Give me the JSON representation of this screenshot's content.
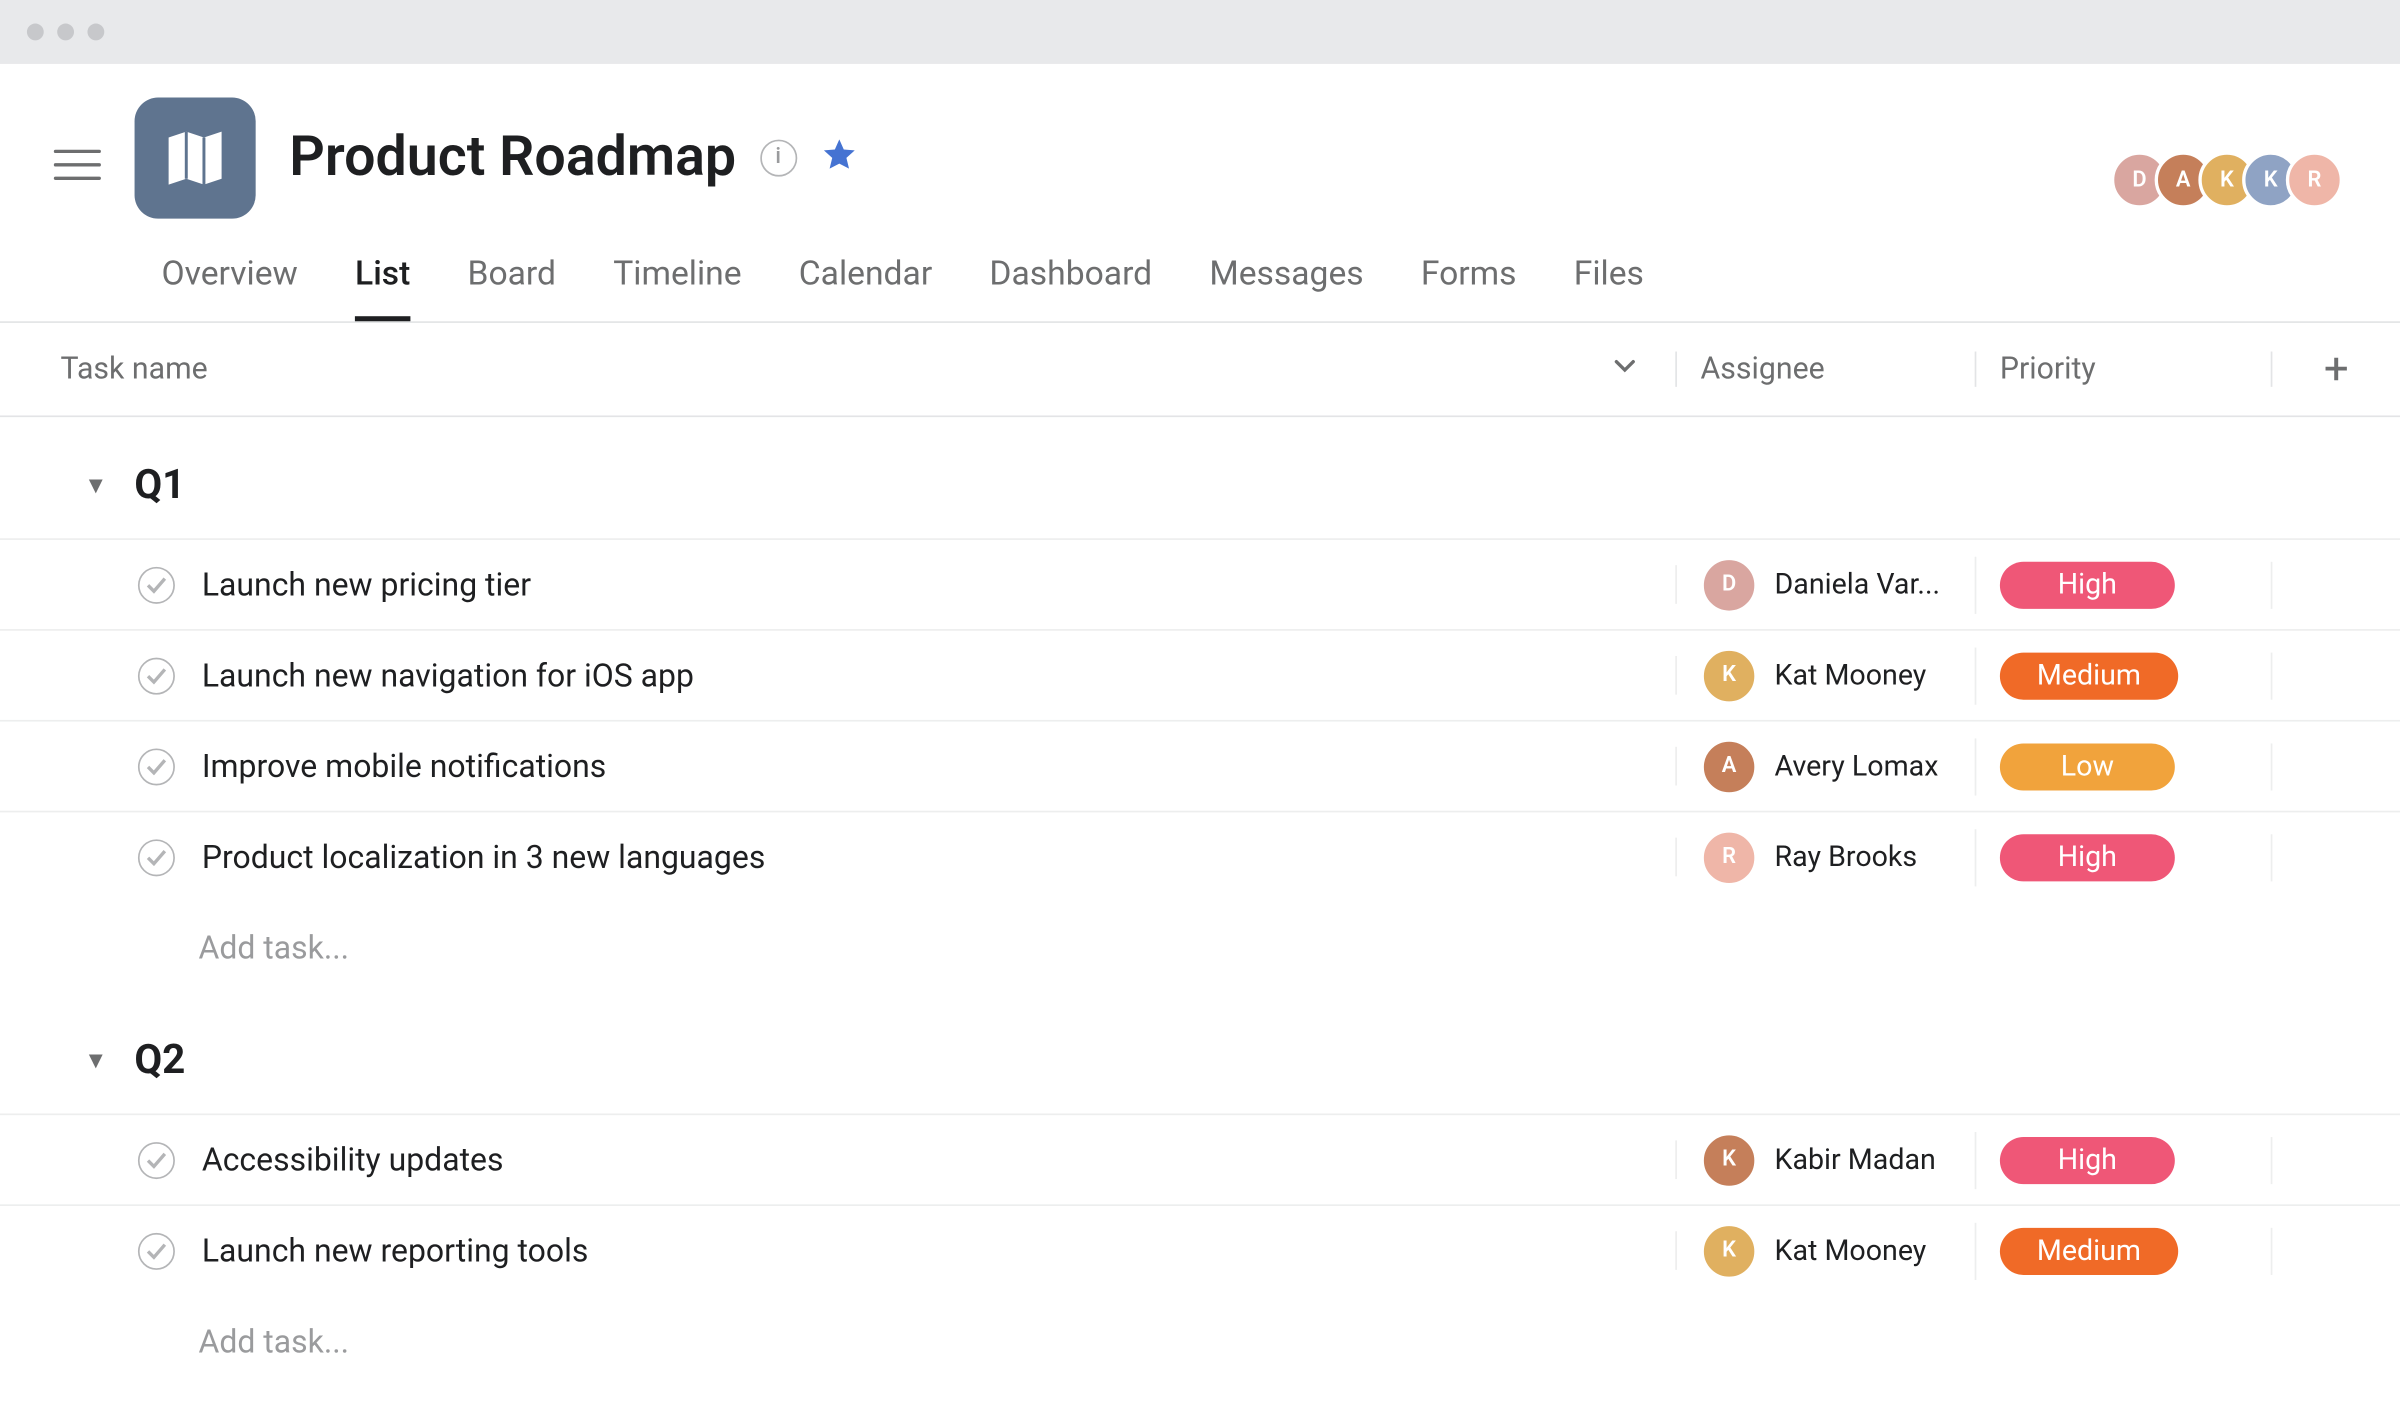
{
  "project": {
    "title": "Product Roadmap",
    "icon_color": "#5f748f"
  },
  "tabs": [
    {
      "label": "Overview",
      "active": false
    },
    {
      "label": "List",
      "active": true
    },
    {
      "label": "Board",
      "active": false
    },
    {
      "label": "Timeline",
      "active": false
    },
    {
      "label": "Calendar",
      "active": false
    },
    {
      "label": "Dashboard",
      "active": false
    },
    {
      "label": "Messages",
      "active": false
    },
    {
      "label": "Forms",
      "active": false
    },
    {
      "label": "Files",
      "active": false
    }
  ],
  "columns": {
    "task": "Task name",
    "assignee": "Assignee",
    "priority": "Priority"
  },
  "add_task_label": "Add task...",
  "priority_colors": {
    "High": "#ef5777",
    "Medium": "#f06a27",
    "Low": "#f1a33c"
  },
  "avatar_colors": [
    "#b98ad9",
    "#c57f5a",
    "#e0b060",
    "#8fa3c4",
    "#efb6a8"
  ],
  "collaborators": [
    {
      "name": "Daniela",
      "color": "#d9a6a0"
    },
    {
      "name": "Avery",
      "color": "#c57f5a"
    },
    {
      "name": "Kat",
      "color": "#e0b060"
    },
    {
      "name": "Kabir",
      "color": "#8fa3c4"
    },
    {
      "name": "Ray",
      "color": "#efb6a8"
    }
  ],
  "sections": [
    {
      "name": "Q1",
      "tasks": [
        {
          "title": "Launch new pricing tier",
          "assignee": "Daniela Var...",
          "avatar_color": "#d9a6a0",
          "priority": "High"
        },
        {
          "title": "Launch new navigation for iOS app",
          "assignee": "Kat Mooney",
          "avatar_color": "#e0b060",
          "priority": "Medium"
        },
        {
          "title": "Improve mobile notifications",
          "assignee": "Avery Lomax",
          "avatar_color": "#c57f5a",
          "priority": "Low"
        },
        {
          "title": "Product localization in 3 new languages",
          "assignee": "Ray Brooks",
          "avatar_color": "#efb6a8",
          "priority": "High"
        }
      ]
    },
    {
      "name": "Q2",
      "tasks": [
        {
          "title": "Accessibility updates",
          "assignee": "Kabir Madan",
          "avatar_color": "#c57f5a",
          "priority": "High"
        },
        {
          "title": "Launch new reporting tools",
          "assignee": "Kat Mooney",
          "avatar_color": "#e0b060",
          "priority": "Medium"
        }
      ]
    }
  ]
}
